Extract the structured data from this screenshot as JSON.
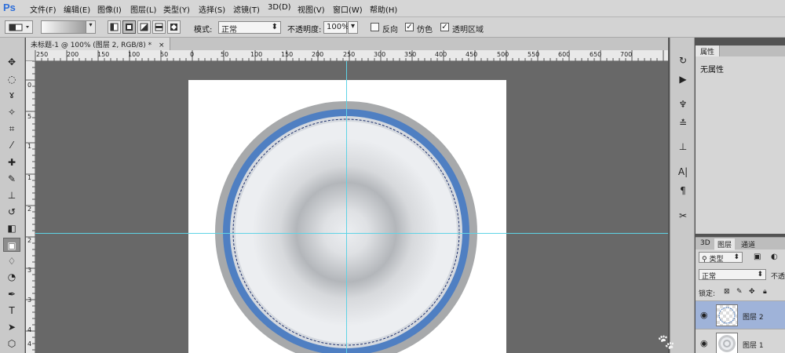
{
  "app": {
    "logo": "Ps"
  },
  "menu": [
    "文件(F)",
    "编辑(E)",
    "图像(I)",
    "图层(L)",
    "类型(Y)",
    "选择(S)",
    "滤镜(T)",
    "3D(D)",
    "视图(V)",
    "窗口(W)",
    "帮助(H)"
  ],
  "options": {
    "mode_label": "模式:",
    "mode_value": "正常",
    "opacity_label": "不透明度:",
    "opacity_value": "100%",
    "reverse_label": "反向",
    "reverse_checked": false,
    "dither_label": "仿色",
    "dither_checked": true,
    "transparency_label": "透明区域",
    "transparency_checked": true
  },
  "document": {
    "tab_title": "未标题-1 @ 100% (图层 2, RGB/8) *",
    "close": "×"
  },
  "ruler_top_labels": [
    "250",
    "200",
    "150",
    "100",
    "50",
    "0",
    "50",
    "100",
    "150",
    "200",
    "250",
    "300",
    "350",
    "400",
    "450",
    "500",
    "550",
    "600",
    "650",
    "700"
  ],
  "ruler_left_labels": [
    "0",
    "5",
    "1",
    "1",
    "2",
    "2",
    "3",
    "3",
    "4",
    "4"
  ],
  "properties": {
    "tab": "属性",
    "content": "无属性"
  },
  "layers_panel": {
    "tabs": [
      "3D",
      "图层",
      "通道"
    ],
    "active_tab": "图层",
    "filter_label": "类型",
    "blend_mode": "正常",
    "opacity_short": "不透",
    "lock_label": "锁定:",
    "layers": [
      {
        "name": "图层 2",
        "selected": true,
        "visible": true
      },
      {
        "name": "图层 1",
        "selected": false,
        "visible": true
      }
    ]
  },
  "colors": {
    "guide": "#5fd3e6",
    "ring_outer": "#a7a9ab",
    "ring_blue": "#4f7fc2",
    "plate": "#eceef1",
    "canvas_bg": "#686868"
  }
}
